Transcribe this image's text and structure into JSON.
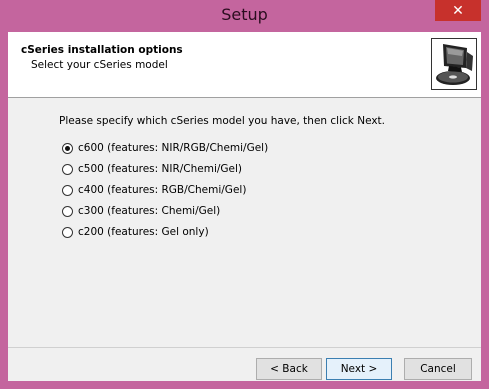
{
  "window": {
    "title": "Setup",
    "close_glyph": "✕"
  },
  "header": {
    "title": "cSeries installation options",
    "subtitle": "Select your cSeries model",
    "icon": "computer-disk-icon"
  },
  "content": {
    "instruction": "Please specify which cSeries model you have, then click Next.",
    "options": [
      {
        "label": "c600 (features: NIR/RGB/Chemi/Gel)",
        "checked": true
      },
      {
        "label": "c500 (features: NIR/Chemi/Gel)",
        "checked": false
      },
      {
        "label": "c400 (features: RGB/Chemi/Gel)",
        "checked": false
      },
      {
        "label": "c300 (features: Chemi/Gel)",
        "checked": false
      },
      {
        "label": "c200 (features: Gel only)",
        "checked": false
      }
    ]
  },
  "buttons": {
    "back": "< Back",
    "next": "Next >",
    "cancel": "Cancel"
  }
}
